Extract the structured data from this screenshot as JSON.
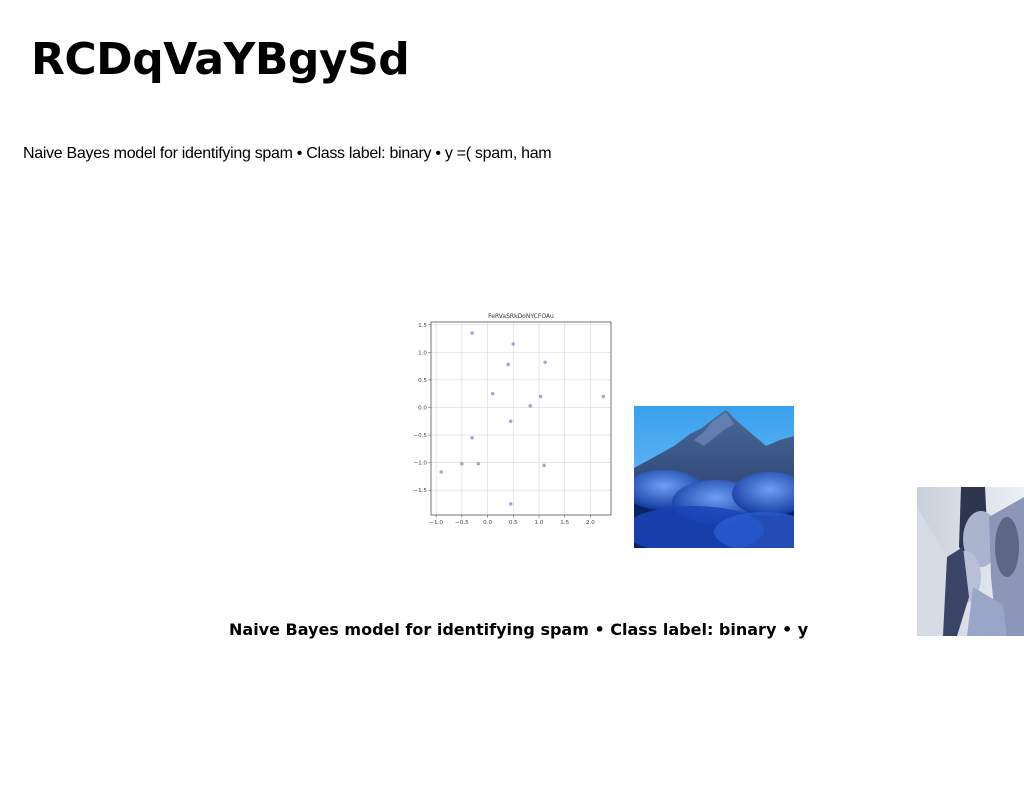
{
  "page": {
    "title": "RCDqVaYBgySd",
    "subtitle": "Naive Bayes model for identifying spam • Class label: binary • y =( spam, ham",
    "caption": "Naive Bayes model for identifying spam • Class label: binary • y"
  },
  "images": {
    "mountain": "mountain-photo",
    "people": "people-photo"
  },
  "chart_data": {
    "type": "scatter",
    "title": "FeRVaSRkDoNYCFOAu",
    "xlabel": "",
    "ylabel": "",
    "xlim": [
      -1.1,
      2.4
    ],
    "ylim": [
      -1.95,
      1.55
    ],
    "xticks": [
      -1.0,
      -0.5,
      0.0,
      0.5,
      1.0,
      1.5,
      2.0
    ],
    "xtick_labels": [
      "−1.0",
      "−0.5",
      "0.0",
      "0.5",
      "1.0",
      "1.5",
      "2.0"
    ],
    "yticks": [
      1.5,
      1.0,
      0.5,
      0.0,
      -0.5,
      -1.0,
      -1.5
    ],
    "ytick_labels": [
      "1.5",
      "1.0",
      "0.5",
      "0.0",
      "−0.5",
      "−1.0",
      "−1.5"
    ],
    "grid": true,
    "point_color": "#9b9fc8",
    "series": [
      {
        "x": [
          -0.3,
          0.5,
          0.4,
          1.12,
          0.1,
          1.03,
          0.83,
          2.25,
          0.45,
          -0.3,
          -0.5,
          -0.18,
          1.1,
          -0.9,
          0.45
        ],
        "y": [
          1.35,
          1.15,
          0.78,
          0.82,
          0.25,
          0.2,
          0.03,
          0.2,
          -0.25,
          -0.55,
          -1.02,
          -1.02,
          -1.05,
          -1.17,
          -1.75
        ]
      }
    ]
  }
}
